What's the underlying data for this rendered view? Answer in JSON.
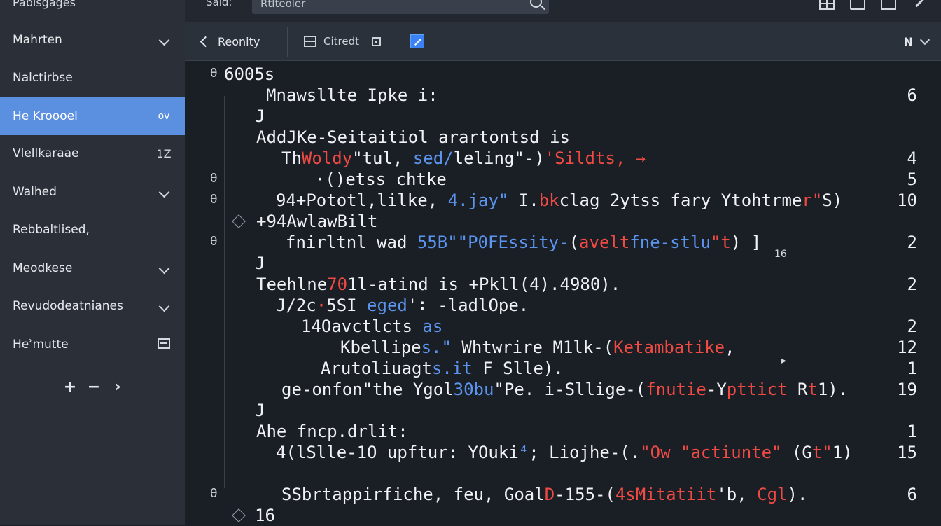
{
  "sidebar": {
    "header": "Pablsgages",
    "items": [
      {
        "label": "Mahrten",
        "trail": "chevron"
      },
      {
        "label": "Nalctirbse",
        "trail": ""
      },
      {
        "label": "He Kroooel",
        "trail": "ov",
        "active": true
      },
      {
        "label": "Vlellkaraae",
        "trail": "1Z"
      },
      {
        "label": "Walhed",
        "trail": "chevron"
      },
      {
        "label": "Rebbaltlised,",
        "trail": ""
      },
      {
        "label": "Meodkese",
        "trail": "chevron"
      },
      {
        "label": "Revudodeatnianes",
        "trail": "chevron"
      },
      {
        "label": "Heʾmutte",
        "trail": "square"
      }
    ],
    "actions": [
      "+",
      "−",
      "›"
    ]
  },
  "topbar": {
    "search_label": "Said:",
    "search_value": "Rtlteoler"
  },
  "toolbar": {
    "back_label": "Reonity",
    "doc_label": "Citredt",
    "right_label": "N"
  },
  "code": {
    "lines": [
      {
        "gutter": "θ",
        "segments": [
          {
            "t": "6005s",
            "c": "w"
          }
        ],
        "num": ""
      },
      {
        "gutter": "",
        "segments": [
          {
            "t": "Mnawsllte Ipke i:",
            "c": "w"
          }
        ],
        "num": "6"
      },
      {
        "gutter": "",
        "segments": [
          {
            "t": "J",
            "c": "w"
          }
        ],
        "num": ""
      },
      {
        "gutter": "",
        "segments": [
          {
            "t": "AddJKe-Seitaitiol arartontsd is",
            "c": "w"
          }
        ],
        "num": ""
      },
      {
        "gutter": "",
        "segments": [
          {
            "t": "Th",
            "c": "w"
          },
          {
            "t": "Woldy",
            "c": "r"
          },
          {
            "t": "\"tul, ",
            "c": "w"
          },
          {
            "t": "sed/",
            "c": "b"
          },
          {
            "t": "leling\"-)",
            "c": "w"
          },
          {
            "t": "'Sildts, →",
            "c": "r"
          }
        ],
        "num": "4"
      },
      {
        "gutter": "θ",
        "segments": [
          {
            "t": "·()etss chtke",
            "c": "w"
          }
        ],
        "num": "5"
      },
      {
        "gutter": "θ",
        "segments": [
          {
            "t": "94+Pototl,lilke, ",
            "c": "w"
          },
          {
            "t": "4.jay\"",
            "c": "b"
          },
          {
            "t": " I.",
            "c": "w"
          },
          {
            "t": "bk",
            "c": "r"
          },
          {
            "t": "clag 2ytss fary Ytohtrme",
            "c": "w"
          },
          {
            "t": "r\"",
            "c": "r"
          },
          {
            "t": "S)",
            "c": "w"
          }
        ],
        "num": "10"
      },
      {
        "gutter": "",
        "segments": [
          {
            "t": "+94AwlawBilt",
            "c": "w"
          }
        ],
        "num": ""
      },
      {
        "gutter": "θ",
        "segments": [
          {
            "t": "fnirltnl wad ",
            "c": "w"
          },
          {
            "t": "55B\"\"P0FEssity-",
            "c": "b"
          },
          {
            "t": "(",
            "c": "w"
          },
          {
            "t": "avelt",
            "c": "r"
          },
          {
            "t": "fne-stlu",
            "c": "b"
          },
          {
            "t": "\"t",
            "c": "r"
          },
          {
            "t": ") ]",
            "c": "w"
          }
        ],
        "num": "2"
      },
      {
        "gutter": "",
        "segments": [
          {
            "t": "J",
            "c": "w"
          }
        ],
        "num": ""
      },
      {
        "gutter": "",
        "segments": [
          {
            "t": "Teehlne",
            "c": "w"
          },
          {
            "t": "70",
            "c": "r"
          },
          {
            "t": "1l-atind is +Pkll(4).4980).",
            "c": "w"
          }
        ],
        "num": "2"
      },
      {
        "gutter": "",
        "segments": [
          {
            "t": "J/2c",
            "c": "w"
          },
          {
            "t": "·",
            "c": "r"
          },
          {
            "t": "5SI ",
            "c": "w"
          },
          {
            "t": "eged",
            "c": "b"
          },
          {
            "t": "'∶ -ladlOpe.",
            "c": "w"
          }
        ],
        "num": ""
      },
      {
        "gutter": "",
        "segments": [
          {
            "t": "14Oavctlcts ",
            "c": "w"
          },
          {
            "t": "as",
            "c": "b"
          }
        ],
        "num": "2"
      },
      {
        "gutter": "",
        "segments": [
          {
            "t": "Kbellipe",
            "c": "w"
          },
          {
            "t": "s.\"",
            "c": "b"
          },
          {
            "t": " Whtwrire M1lk-(",
            "c": "w"
          },
          {
            "t": "Ketambatike",
            "c": "r"
          },
          {
            "t": ",",
            "c": "w"
          }
        ],
        "num": "12"
      },
      {
        "gutter": "",
        "segments": [
          {
            "t": "Arutoliuagt",
            "c": "w"
          },
          {
            "t": "s.",
            "c": "b"
          },
          {
            "t": "it",
            "c": "b"
          },
          {
            "t": " F Slle).",
            "c": "w"
          }
        ],
        "num": "1"
      },
      {
        "gutter": "",
        "segments": [
          {
            "t": "ge-onfon\"the Ygol",
            "c": "w"
          },
          {
            "t": "30bu",
            "c": "b"
          },
          {
            "t": "\"Pe. i-Sllige-(",
            "c": "w"
          },
          {
            "t": "fnutie",
            "c": "r"
          },
          {
            "t": "-Y",
            "c": "w"
          },
          {
            "t": "pttict",
            "c": "r"
          },
          {
            "t": " R",
            "c": "w"
          },
          {
            "t": "t",
            "c": "r"
          },
          {
            "t": "1).",
            "c": "w"
          }
        ],
        "num": "19"
      },
      {
        "gutter": "",
        "segments": [
          {
            "t": "J",
            "c": "w"
          }
        ],
        "num": ""
      },
      {
        "gutter": "",
        "segments": [
          {
            "t": "Ahe fncp.drlit:",
            "c": "w"
          }
        ],
        "num": "1"
      },
      {
        "gutter": "",
        "segments": [
          {
            "t": "4(lSlle-1O upftur: YOuki",
            "c": "w"
          },
          {
            "t": "⁴",
            "c": "b"
          },
          {
            "t": "; Liojhe-(.",
            "c": "w"
          },
          {
            "t": "\"Ow",
            "c": "r"
          },
          {
            "t": " ",
            "c": "w"
          },
          {
            "t": "\"actiunte\"",
            "c": "r"
          },
          {
            "t": " (G",
            "c": "w"
          },
          {
            "t": "t\"",
            "c": "r"
          },
          {
            "t": "1)",
            "c": "w"
          }
        ],
        "num": "15"
      },
      {
        "gutter": "",
        "segments": [],
        "num": ""
      },
      {
        "gutter": "θ",
        "segments": [
          {
            "t": "SSbrtappirfiche, feu, Goal",
            "c": "w"
          },
          {
            "t": "D",
            "c": "r"
          },
          {
            "t": "-155-(",
            "c": "w"
          },
          {
            "t": "4sMitatiit",
            "c": "r"
          },
          {
            "t": "'b, ",
            "c": "w"
          },
          {
            "t": "Cgl",
            "c": "r"
          },
          {
            "t": ").",
            "c": "w"
          }
        ],
        "num": "6"
      },
      {
        "gutter": "",
        "segments": [
          {
            "t": "16",
            "c": "w"
          }
        ],
        "num": ""
      }
    ],
    "notes": [
      {
        "text": "16"
      },
      {
        "text": "▸"
      }
    ]
  },
  "colors": {
    "accent": "#5b8fe0",
    "code_red": "#ef4a43",
    "code_blue": "#5b95f0",
    "background": "#1a1e25",
    "sidebar": "#2a2f38"
  }
}
